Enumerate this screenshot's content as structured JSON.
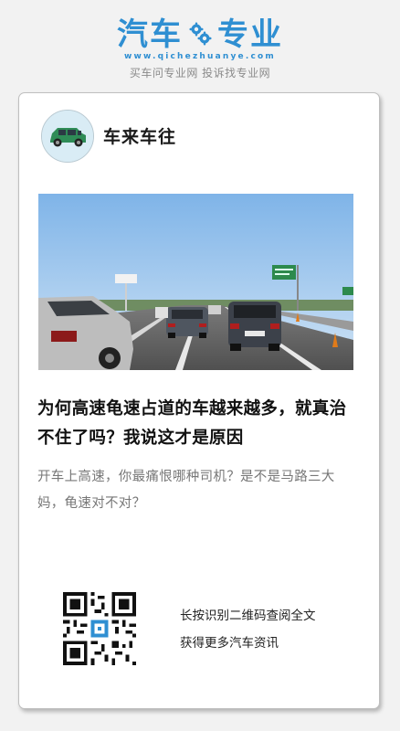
{
  "header": {
    "logo_left": "汽车",
    "logo_right": "专业",
    "logo_icon": "gear-icon",
    "url": "www.qichezhuanye.com",
    "slogan": "买车问专业网 投诉找专业网"
  },
  "card": {
    "author": "车来车往",
    "avatar_icon": "green-car-icon",
    "cover_image": "highway-traffic-photo",
    "title": "为何高速龟速占道的车越来越多，就真治不住了吗？我说这才是原因",
    "summary": "开车上高速，你最痛恨哪种司机？是不是马路三大妈，龟速对不对？",
    "qr_line1": "长按识别二维码查阅全文",
    "qr_line2": "获得更多汽车资讯"
  },
  "colors": {
    "brand": "#2f8fd2",
    "background": "#f2f2f2",
    "card": "#ffffff"
  }
}
